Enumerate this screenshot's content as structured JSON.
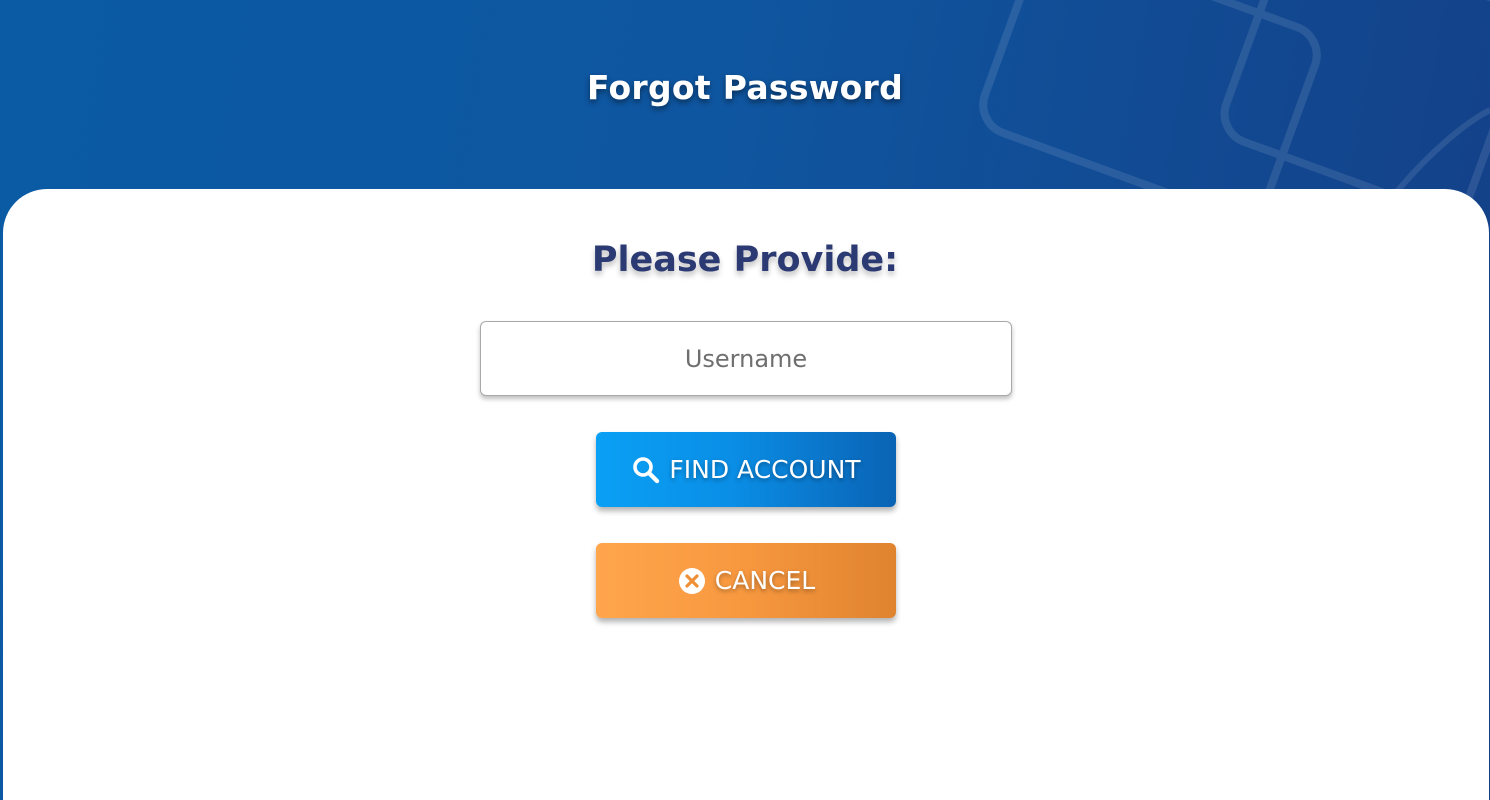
{
  "header": {
    "title": "Forgot Password"
  },
  "form": {
    "heading": "Please Provide:",
    "username_placeholder": "Username",
    "username_value": "",
    "find_button_label": "FIND ACCOUNT",
    "cancel_button_label": "CANCEL"
  },
  "icons": {
    "find": "search-icon",
    "cancel": "close-circle-icon"
  },
  "colors": {
    "header_bg": "#0f56a0",
    "heading_text": "#2b3a72",
    "find_button": "#0a8ee6",
    "cancel_button": "#f7983f"
  }
}
